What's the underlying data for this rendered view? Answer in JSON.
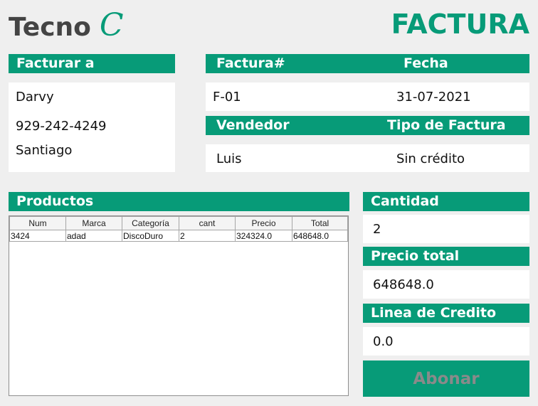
{
  "header": {
    "logo_text": "Tecno",
    "logo_mark": "C",
    "title": "FACTURA"
  },
  "bill_to": {
    "label": "Facturar a",
    "name": "Darvy",
    "phone": "929-242-4249",
    "city": "Santiago"
  },
  "invoice": {
    "number_label": "Factura#",
    "date_label": "Fecha",
    "number": "F-01",
    "date": "31-07-2021",
    "seller_label": "Vendedor",
    "type_label": "Tipo de Factura",
    "seller": "Luis",
    "type": "Sin crédito"
  },
  "products": {
    "label": "Productos",
    "columns": [
      "Num",
      "Marca",
      "Categoría",
      "cant",
      "Precio",
      "Total"
    ],
    "rows": [
      [
        "3424",
        "adad",
        "DiscoDuro",
        "2",
        "324324.0",
        "648648.0"
      ]
    ]
  },
  "summary": {
    "quantity_label": "Cantidad",
    "quantity": "2",
    "total_label": "Precio total",
    "total": "648648.0",
    "credit_label": "Linea de Credito",
    "credit": "0.0",
    "pay_button": "Abonar"
  },
  "colors": {
    "accent": "#079b78",
    "background": "#efefef",
    "disabled_text": "#8a8a8a"
  }
}
